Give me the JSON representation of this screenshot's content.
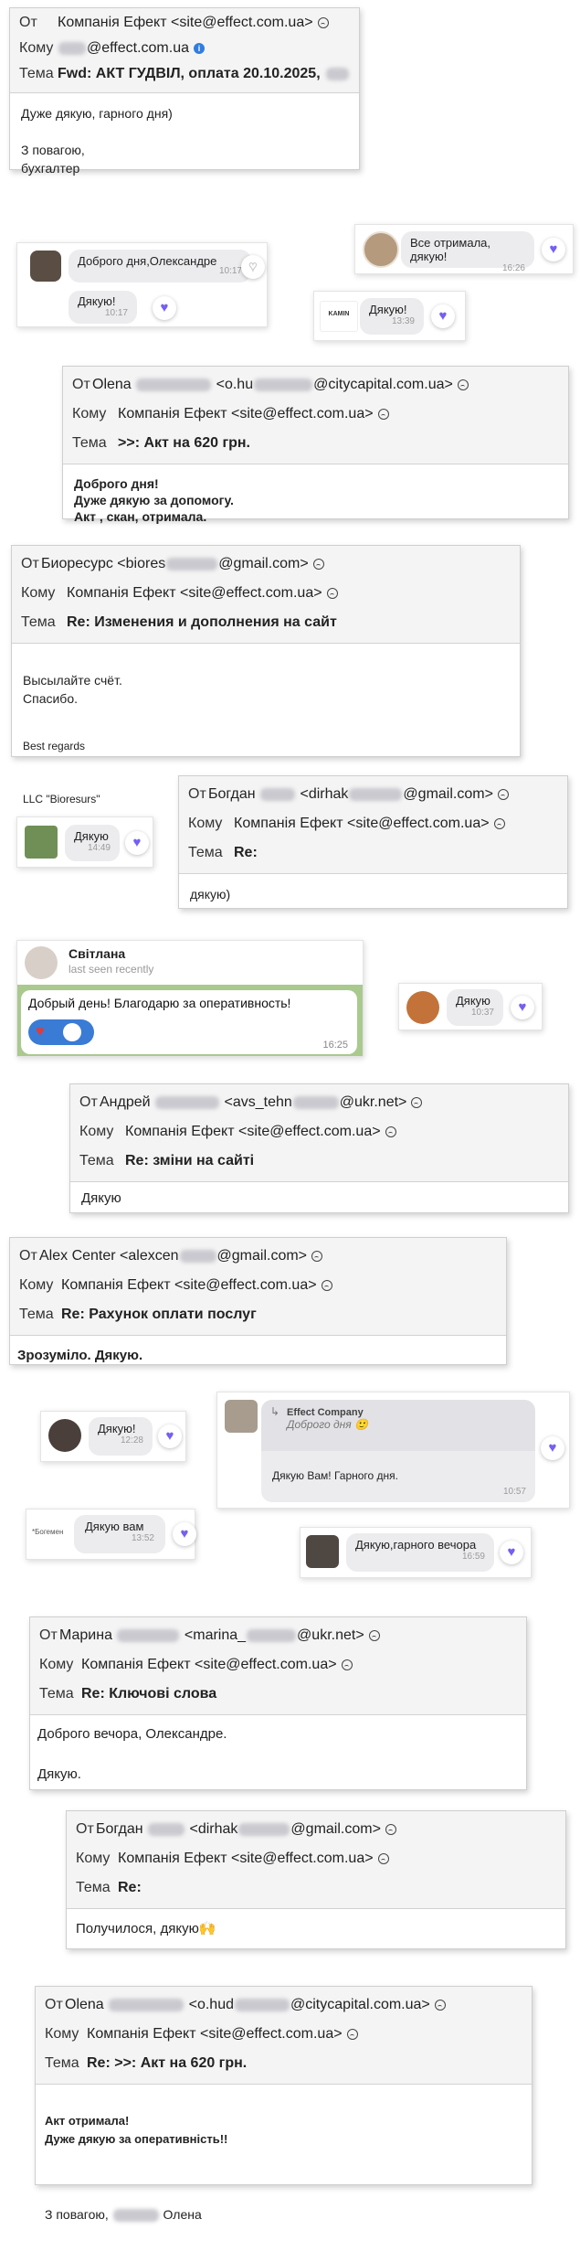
{
  "labels": {
    "from": "От",
    "to": "Кому",
    "subject": "Тема"
  },
  "emails": [
    {
      "id": "e1",
      "from": "Компанія Ефект <site@effect.com.ua>",
      "to_suffix": "@effect.com.ua",
      "subject": "Fwd: АКТ ГУДВІЛ, оплата 20.10.2025,",
      "body": "Дуже дякую, гарного дня)\n\nЗ повагою,\nбухгалтер"
    },
    {
      "id": "e2",
      "from_pre": "Olena",
      "from_mid": "<o.hu",
      "from_end": "@citycapital.com.ua>",
      "to": "Компанія Ефект <site@effect.com.ua>",
      "subject": ">>: Акт на 620 грн.",
      "body": "Доброго дня!\nДуже дякую за допомогу.\nАкт , скан, отримала."
    },
    {
      "id": "e3",
      "from_pre": "Биоресурс <biores",
      "from_end": "@gmail.com>",
      "to": "Компанія Ефект <site@effect.com.ua>",
      "subject": "Re: Изменения и дополнения на сайт",
      "body1": "Высылайте счёт.\nСпасибо.",
      "body2": "Best regards",
      "body3": "LLC  \"Bioresurs\""
    },
    {
      "id": "e4",
      "from_pre": "Богдан",
      "from_mid": "<dirhak",
      "from_end": "@gmail.com>",
      "to": "Компанія Ефект <site@effect.com.ua>",
      "subject": "Re:",
      "body": "дякую)"
    },
    {
      "id": "e5",
      "from_pre": "Андрей",
      "from_mid": "<avs_tehn",
      "from_end": "@ukr.net>",
      "to": "Компанія Ефект <site@effect.com.ua>",
      "subject": "Re: зміни на сайті",
      "body": "Дякую"
    },
    {
      "id": "e6",
      "from_pre": "Alex Center <alexcen",
      "from_end": "@gmail.com>",
      "to": "Компанія Ефект <site@effect.com.ua>",
      "subject": "Re: Рахунок оплати послуг",
      "body": "Зрозуміло. Дякую."
    },
    {
      "id": "e7",
      "from_pre": "Марина",
      "from_mid": "<marina_",
      "from_end": "@ukr.net>",
      "to": "Компанія Ефект <site@effect.com.ua>",
      "subject": "Re: Ключові слова",
      "body": "Доброго вечора, Олександре.\n\nДякую."
    },
    {
      "id": "e8",
      "from_pre": "Богдан",
      "from_mid": "<dirhak",
      "from_end": "@gmail.com>",
      "to": "Компанія Ефект <site@effect.com.ua>",
      "subject": "Re:",
      "body": "Получилося, дякую🙌"
    },
    {
      "id": "e9",
      "from_pre": "Olena",
      "from_mid": "<o.hud",
      "from_end": "@citycapital.com.ua>",
      "to": "Компанія Ефект <site@effect.com.ua>",
      "subject": "Re: >>: Акт на 620 грн.",
      "body1": "Акт отримала!\nДуже дякую за оперативність!!",
      "body2_pre": "З повагою,",
      "body2_end": "Олена"
    }
  ],
  "chats": {
    "c1": {
      "msg1": "Доброго дня,Олександре",
      "time1": "10:17",
      "msg2": "Дякую!",
      "time2": "10:17"
    },
    "c2": {
      "msg": "Все отримала, дякую!",
      "time": "16:26"
    },
    "c3": {
      "avatar_text": "KAMIN",
      "msg": "Дякую!",
      "time": "13:39"
    },
    "c4": {
      "msg": "Дякую",
      "time": "14:49"
    },
    "c5": {
      "name": "Світлана",
      "status": "last seen recently",
      "msg": "Добрый день! Благодарю за  оперативность!",
      "time": "16:25"
    },
    "c6": {
      "msg": "Дякую",
      "time": "10:37"
    },
    "c7": {
      "msg": "Дякую!",
      "time": "12:28"
    },
    "c8": {
      "reply_name": "Effect Company",
      "reply_text": "Доброго дня 🙂",
      "msg": "Дякую Вам! Гарного дня.",
      "time": "10:57"
    },
    "c9": {
      "avatar_text": "*Богемен",
      "msg": "Дякую вам",
      "time": "13:52"
    },
    "c10": {
      "msg": "Дякую,гарного вечора",
      "time": "16:59"
    }
  },
  "colors": {
    "accent": "#7360f2",
    "telegram_green": "#a9c98e",
    "telegram_bubble": "#ffffff"
  },
  "icons": [
    "heart-reaction-icon",
    "sad-face-icon",
    "info-icon",
    "reply-arrow-icon"
  ]
}
